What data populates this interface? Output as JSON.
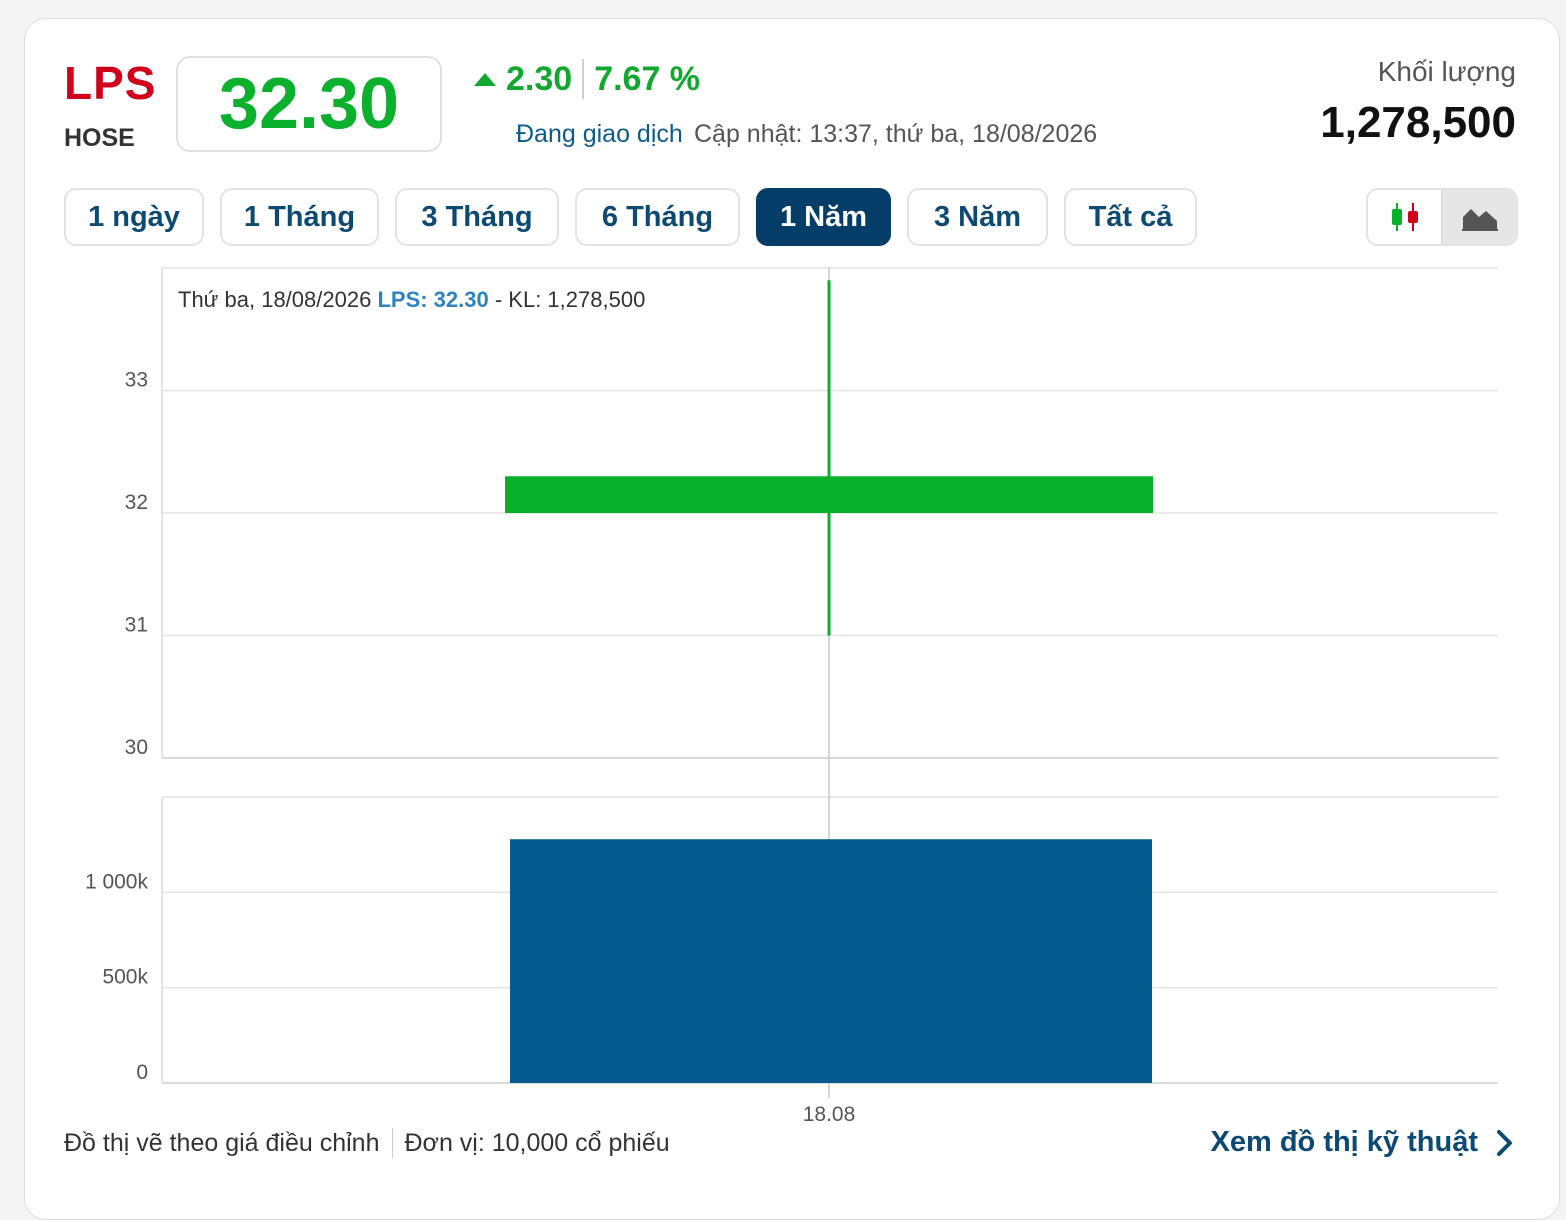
{
  "stock": {
    "ticker": "LPS",
    "exchange": "HOSE",
    "price": "32.30",
    "change": "2.30",
    "change_pct": "7.67 %",
    "status": "Đang giao dịch",
    "updated": "Cập nhật: 13:37, thứ ba, 18/08/2026",
    "volume_label": "Khối lượng",
    "volume": "1,278,500"
  },
  "tabs": [
    {
      "label": "1 ngày",
      "active": false
    },
    {
      "label": "1 Tháng",
      "active": false
    },
    {
      "label": "3 Tháng",
      "active": false
    },
    {
      "label": "6 Tháng",
      "active": false
    },
    {
      "label": "1 Năm",
      "active": true
    },
    {
      "label": "3 Năm",
      "active": false
    },
    {
      "label": "Tất cả",
      "active": false
    }
  ],
  "toggle": {
    "options": [
      {
        "icon": "candlestick-icon",
        "active": false
      },
      {
        "icon": "area-chart-icon",
        "active": true
      }
    ]
  },
  "tooltip": {
    "date": "Thứ ba, 18/08/2026",
    "price_text": "LPS: 32.30",
    "volume_text": "- KL: 1,278,500"
  },
  "colors": {
    "up": "#09b02c",
    "volume": "#035a8c",
    "ticker": "#d0021b",
    "accent": "#033d68",
    "tooltip_price": "#2e83bd"
  },
  "chart_data": [
    {
      "type": "candlestick",
      "x": [
        "18.08"
      ],
      "series": [
        {
          "x": "18.08",
          "open": 32.0,
          "high": 33.9,
          "low": 31.0,
          "close": 32.3
        }
      ],
      "yticks": [
        "30",
        "31",
        "32",
        "33"
      ],
      "ylim": [
        30,
        34
      ],
      "grid": true
    },
    {
      "type": "bar",
      "categories": [
        "18.08"
      ],
      "values": [
        1278500
      ],
      "yticks": [
        "0",
        "500k",
        "1 000k"
      ],
      "ylim": [
        0,
        1500000
      ],
      "xlabel_ticks": [
        "18.08"
      ],
      "grid": true
    }
  ],
  "footer": {
    "note": "Đồ thị vẽ theo giá điều chỉnh",
    "unit": "Đơn vị: 10,000 cổ phiếu",
    "link": "Xem đồ thị kỹ thuật"
  }
}
